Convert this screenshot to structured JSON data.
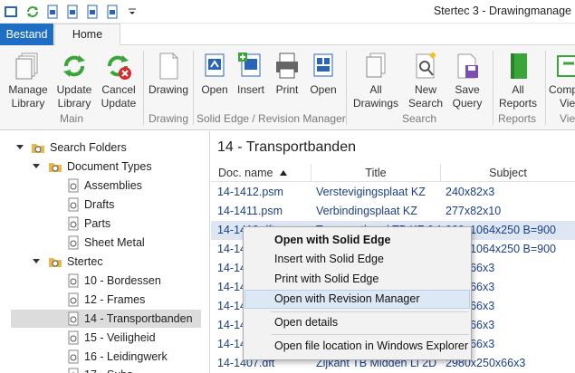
{
  "window": {
    "title": "Stertec 3 - Drawingmanage"
  },
  "tabs": {
    "file": "Bestand",
    "home": "Home"
  },
  "ribbon": {
    "buttons": [
      {
        "label1": "Manage",
        "label2": "Library"
      },
      {
        "label1": "Update",
        "label2": "Library"
      },
      {
        "label1": "Cancel",
        "label2": "Update"
      },
      {
        "label1": "Drawing",
        "label2": ""
      },
      {
        "label1": "Open",
        "label2": ""
      },
      {
        "label1": "Insert",
        "label2": ""
      },
      {
        "label1": "Print",
        "label2": ""
      },
      {
        "label1": "Open",
        "label2": ""
      },
      {
        "label1": "All",
        "label2": "Drawings"
      },
      {
        "label1": "New",
        "label2": "Search"
      },
      {
        "label1": "Save",
        "label2": "Query"
      },
      {
        "label1": "All",
        "label2": "Reports"
      },
      {
        "label1": "Comp",
        "label2": "Vie"
      }
    ],
    "groups": [
      "Main",
      "Drawing",
      "Solid Edge / Revision Manager",
      "Search",
      "Reports",
      "Vie"
    ]
  },
  "tree": {
    "root": "Search Folders",
    "document_types": "Document Types",
    "doc_items": [
      "Assemblies",
      "Drafts",
      "Parts",
      "Sheet Metal"
    ],
    "stertec": "Stertec",
    "stertec_items": [
      "10 - Bordessen",
      "12 - Frames",
      "14 - Transportbanden",
      "15 - Veiligheid",
      "16 - Leidingwerk",
      "17 - Subs"
    ]
  },
  "pane": {
    "title": "14 - Transportbanden",
    "columns": [
      "Doc. name",
      "Title",
      "Subject"
    ],
    "rows": [
      {
        "name": "14-1412.psm",
        "title": "Verstevigingsplaat KZ",
        "subject": "240x82x3"
      },
      {
        "name": "14-1411.psm",
        "title": "Verbindingsplaat KZ",
        "subject": "277x82x10"
      },
      {
        "name": "14-1410.dft",
        "title": "Transportband TB KZ 0.9m",
        "subject": "900x1064x250 B=900"
      },
      {
        "name": "14-1409.dft",
        "title": "",
        "subject": "900x1064x250 B=900"
      },
      {
        "name": "14-1408.psm",
        "title": "",
        "subject": "250x66x3"
      },
      {
        "name": "14-1406.psm",
        "title": "",
        "subject": "250x66x3"
      },
      {
        "name": "14-1405.psm",
        "title": "",
        "subject": "250x66x3"
      },
      {
        "name": "14-1404.psm",
        "title": "",
        "subject": "250x66x3"
      },
      {
        "name": "14-1403.psm",
        "title": "",
        "subject": "250x66x3"
      },
      {
        "name": "14-1402.psm",
        "title": "",
        "subject": "250x66x3"
      },
      {
        "name": "14-1407.dft",
        "title": "Zijkant TB Midden Li 2D",
        "subject": "2980x250x66x3"
      }
    ]
  },
  "context_menu": {
    "items": [
      "Open with Solid Edge",
      "Insert with Solid Edge",
      "Print with Solid Edge",
      "Open with Revision Manager",
      "Open details",
      "Open file location in Windows Explorer"
    ]
  },
  "colors": {
    "accent": "#1e6fc4",
    "link_text": "#1b3f8b",
    "folder": "#e8b84a",
    "green": "#3aa63a"
  }
}
